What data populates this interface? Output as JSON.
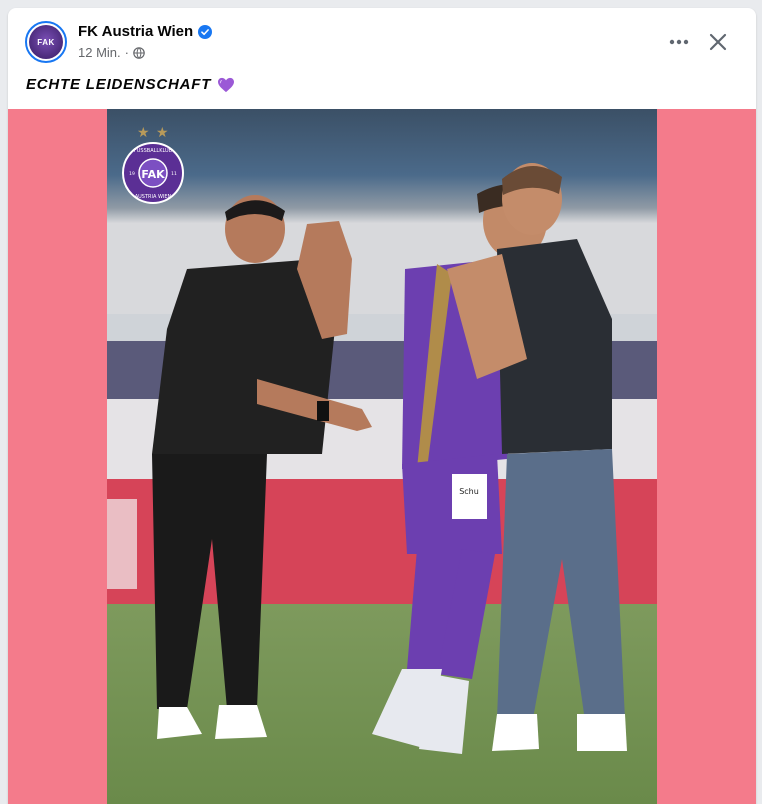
{
  "post": {
    "page_name": "FK Austria Wien",
    "timestamp": "12 Min.",
    "separator": "·",
    "caption": "ECHTE LEIDENSCHAFT",
    "avatar_text": "FAK"
  },
  "icons": {
    "verified": "verified-badge-icon",
    "privacy": "globe-icon",
    "more": "more-options-icon",
    "close": "close-icon",
    "emoji": "purple-heart-icon"
  },
  "colors": {
    "accent": "#1877f2",
    "media_background": "#f47b8b",
    "club_purple": "#6a3fa0"
  },
  "image": {
    "logo_text_top": "FUSSBALLKLUB",
    "logo_text_bottom": "AUSTRIA WIEN",
    "logo_monogram": "FAK",
    "logo_year_left": "19",
    "logo_year_right": "11",
    "sponsor_text": "Schu"
  }
}
